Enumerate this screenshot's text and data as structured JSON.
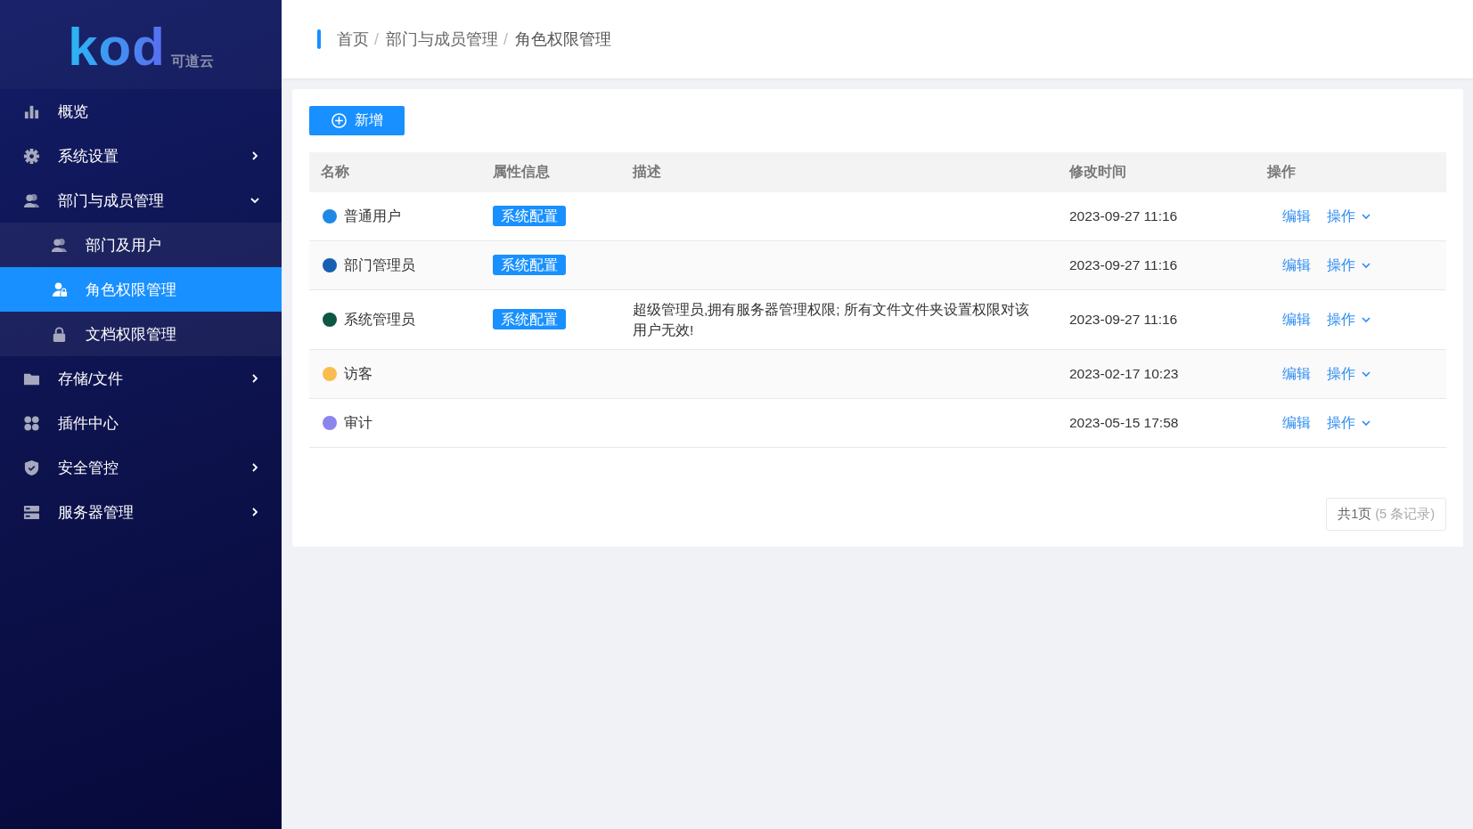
{
  "logo": {
    "wordmark": "kod",
    "subtitle": "可道云"
  },
  "sidebar": {
    "items": [
      {
        "label": "概览",
        "expandable": false,
        "expanded": false,
        "selected": false
      },
      {
        "label": "系统设置",
        "expandable": true,
        "expanded": false,
        "selected": false
      },
      {
        "label": "部门与成员管理",
        "expandable": true,
        "expanded": true,
        "selected": false,
        "children": [
          {
            "label": "部门及用户",
            "selected": false
          },
          {
            "label": "角色权限管理",
            "selected": true
          },
          {
            "label": "文档权限管理",
            "selected": false
          }
        ]
      },
      {
        "label": "存储/文件",
        "expandable": true,
        "expanded": false,
        "selected": false
      },
      {
        "label": "插件中心",
        "expandable": false,
        "expanded": false,
        "selected": false
      },
      {
        "label": "安全管控",
        "expandable": true,
        "expanded": false,
        "selected": false
      },
      {
        "label": "服务器管理",
        "expandable": true,
        "expanded": false,
        "selected": false
      }
    ]
  },
  "breadcrumb": {
    "separator": "/",
    "items": [
      "首页",
      "部门与成员管理",
      "角色权限管理"
    ]
  },
  "add_button": "新增",
  "table": {
    "columns": [
      "名称",
      "属性信息",
      "描述",
      "修改时间",
      "操作"
    ],
    "rows": [
      {
        "name": "普通用户",
        "color": "#1e88e5",
        "tag": "系统配置",
        "modified": "2023-09-27 11:16",
        "actions": [
          "编辑",
          "操作"
        ]
      },
      {
        "name": "部门管理员",
        "color": "#1560b0",
        "tag": "系统配置",
        "modified": "2023-09-27 11:16",
        "actions": [
          "编辑",
          "操作"
        ]
      },
      {
        "name": "系统管理员",
        "color": "#0d5743",
        "tag": "系统配置",
        "description": "超级管理员,拥有服务器管理权限; 所有文件文件夹设置权限对该用户无效!",
        "modified": "2023-09-27 11:16",
        "actions": [
          "编辑",
          "操作"
        ]
      },
      {
        "name": "访客",
        "color": "#fbbc4f",
        "modified": "2023-02-17 10:23",
        "actions": [
          "编辑",
          "操作"
        ]
      },
      {
        "name": "审计",
        "color": "#8d85ee",
        "modified": "2023-05-15 17:58",
        "actions": [
          "编辑",
          "操作"
        ]
      }
    ]
  },
  "pagination": {
    "pages": "共1页",
    "records": "(5 条记录)"
  }
}
